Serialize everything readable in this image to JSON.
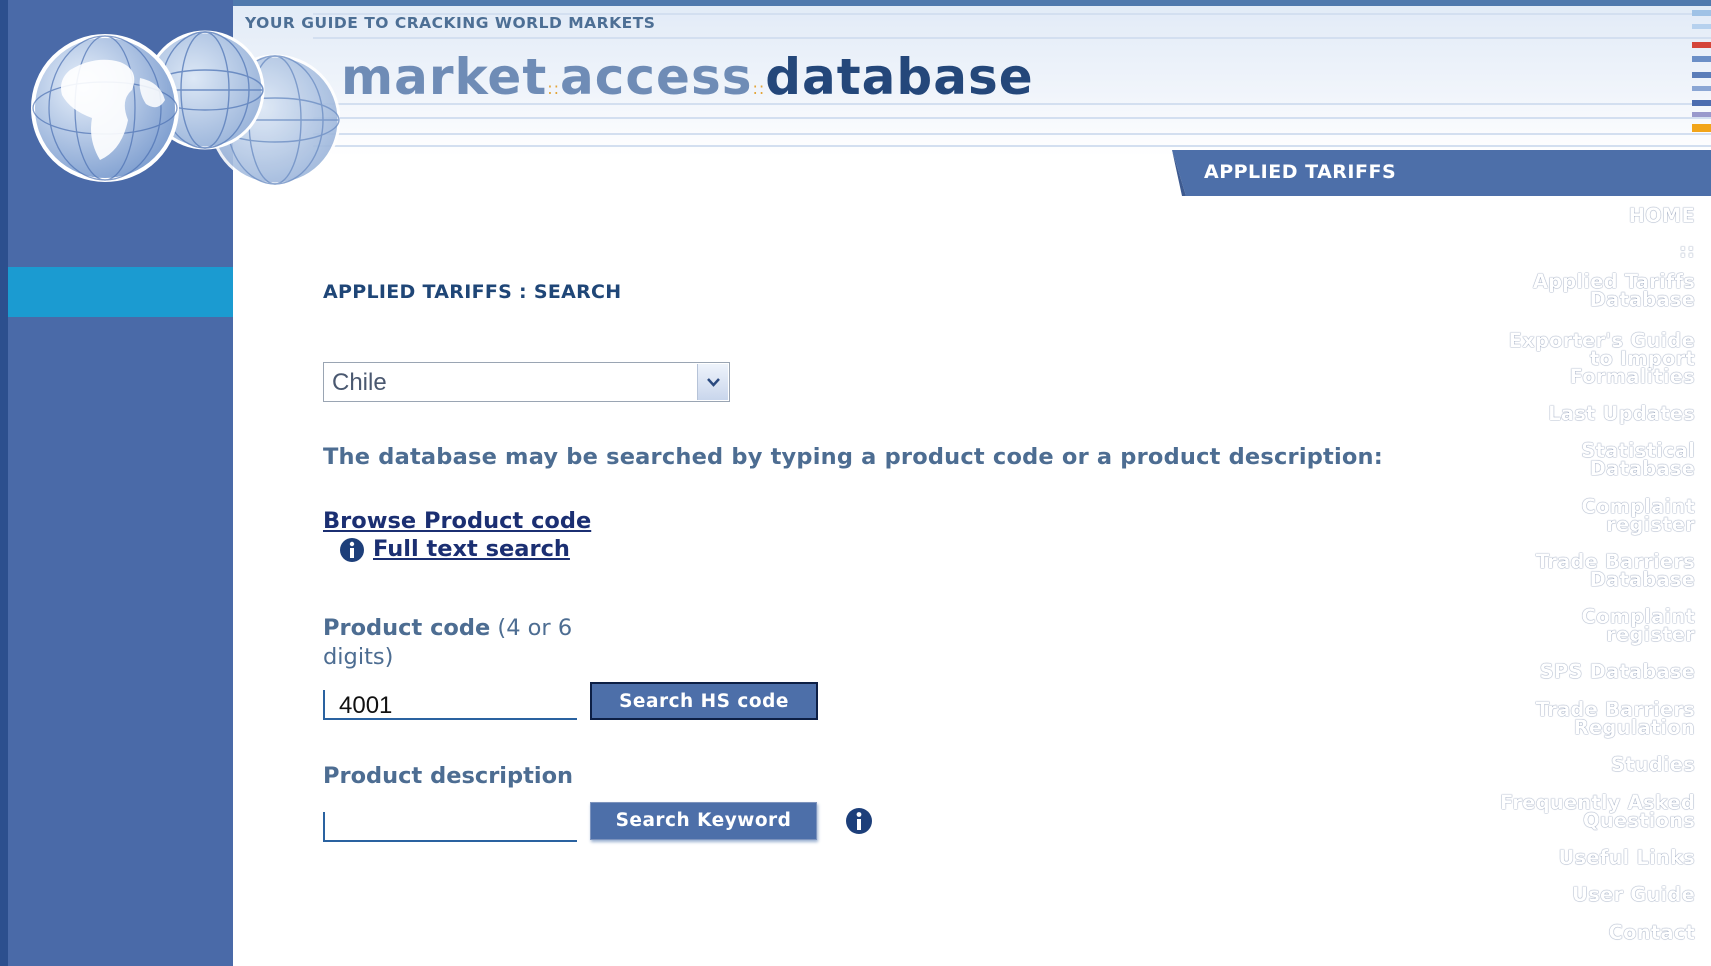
{
  "header": {
    "tagline": "YOUR GUIDE TO CRACKING WORLD MARKETS",
    "logo_word1": "market",
    "logo_word2": "access",
    "logo_word3": "database",
    "section_tab": "APPLIED TARIFFS"
  },
  "sidebar": {
    "items": [
      {
        "lines": [
          "HOME"
        ],
        "active": false
      },
      {
        "lines": [
          "::"
        ],
        "active": false
      },
      {
        "lines": [
          "Applied Tariffs",
          "Database"
        ],
        "active": true
      },
      {
        "lines": [
          "Exporter's Guide",
          "to Import",
          "Formalities"
        ],
        "active": false
      },
      {
        "lines": [
          "Last Updates"
        ],
        "active": false
      },
      {
        "lines": [
          "Statistical",
          "Database"
        ],
        "active": false
      },
      {
        "lines": [
          "Complaint",
          "register"
        ],
        "active": false
      },
      {
        "lines": [
          "Trade Barriers",
          "Database"
        ],
        "active": false
      },
      {
        "lines": [
          "Complaint",
          "register"
        ],
        "active": false
      },
      {
        "lines": [
          "SPS Database"
        ],
        "active": false
      },
      {
        "lines": [
          "Trade Barriers",
          "Regulation"
        ],
        "active": false
      },
      {
        "lines": [
          "Studies"
        ],
        "active": false
      },
      {
        "lines": [
          "Frequently Asked",
          "Questions"
        ],
        "active": false
      },
      {
        "lines": [
          "Useful Links"
        ],
        "active": false
      },
      {
        "lines": [
          "User Guide"
        ],
        "active": false
      },
      {
        "lines": [
          "Contact"
        ],
        "active": false
      }
    ]
  },
  "main": {
    "page_title": "APPLIED TARIFFS : SEARCH",
    "country_select": {
      "selected": "Chile"
    },
    "intro_text": "The database may be searched by typing a product code or a product description:",
    "browse_link": "Browse Product code",
    "fulltext_link": " Full text search",
    "product_code": {
      "label": "Product code",
      "hint": "(4 or 6 digits)",
      "value": "4001",
      "button": "Search HS code"
    },
    "product_description": {
      "label": "Product description",
      "value": "",
      "button": "Search Keyword"
    }
  },
  "colors": {
    "sidebar_bg": "#4a6aa8",
    "sidebar_active": "#1b9bd1",
    "tab_bg": "#4d6fa9",
    "link": "#1b2f72"
  }
}
